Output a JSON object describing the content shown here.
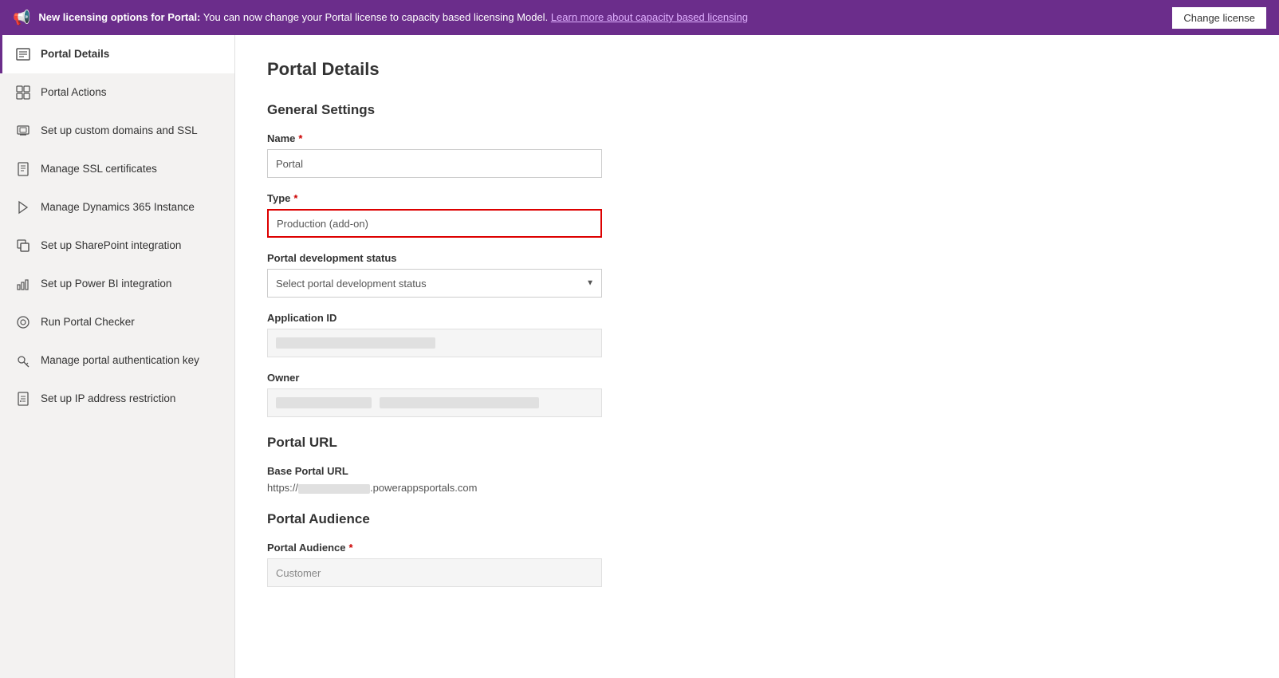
{
  "banner": {
    "icon": "📢",
    "text_bold": "New licensing options for Portal:",
    "text_normal": " You can now change your Portal license to capacity based licensing Model.",
    "link_text": "Learn more about capacity based licensing",
    "button_label": "Change license"
  },
  "sidebar": {
    "items": [
      {
        "id": "portal-details",
        "label": "Portal Details",
        "icon": "☰",
        "active": true
      },
      {
        "id": "portal-actions",
        "label": "Portal Actions",
        "icon": "⊞"
      },
      {
        "id": "custom-domains",
        "label": "Set up custom domains and SSL",
        "icon": "⧉"
      },
      {
        "id": "ssl-certs",
        "label": "Manage SSL certificates",
        "icon": "🗎"
      },
      {
        "id": "dynamics-instance",
        "label": "Manage Dynamics 365 Instance",
        "icon": "▶"
      },
      {
        "id": "sharepoint",
        "label": "Set up SharePoint integration",
        "icon": "S"
      },
      {
        "id": "powerbi",
        "label": "Set up Power BI integration",
        "icon": "📊"
      },
      {
        "id": "portal-checker",
        "label": "Run Portal Checker",
        "icon": "⊙"
      },
      {
        "id": "auth-key",
        "label": "Manage portal authentication key",
        "icon": "🔒"
      },
      {
        "id": "ip-restriction",
        "label": "Set up IP address restriction",
        "icon": "🗋"
      }
    ]
  },
  "content": {
    "page_title": "Portal Details",
    "general_settings": {
      "section_title": "General Settings",
      "name_label": "Name",
      "name_required": "*",
      "name_value": "Portal",
      "type_label": "Type",
      "type_required": "*",
      "type_value": "Production (add-on)",
      "dev_status_label": "Portal development status",
      "dev_status_placeholder": "Select portal development status",
      "app_id_label": "Application ID",
      "owner_label": "Owner"
    },
    "portal_url": {
      "section_title": "Portal URL",
      "base_url_label": "Base Portal URL",
      "base_url_prefix": "https://",
      "base_url_suffix": ".powerappsportals.com"
    },
    "portal_audience": {
      "section_title": "Portal Audience",
      "audience_label": "Portal Audience",
      "audience_required": "*",
      "audience_value": "Customer"
    }
  }
}
